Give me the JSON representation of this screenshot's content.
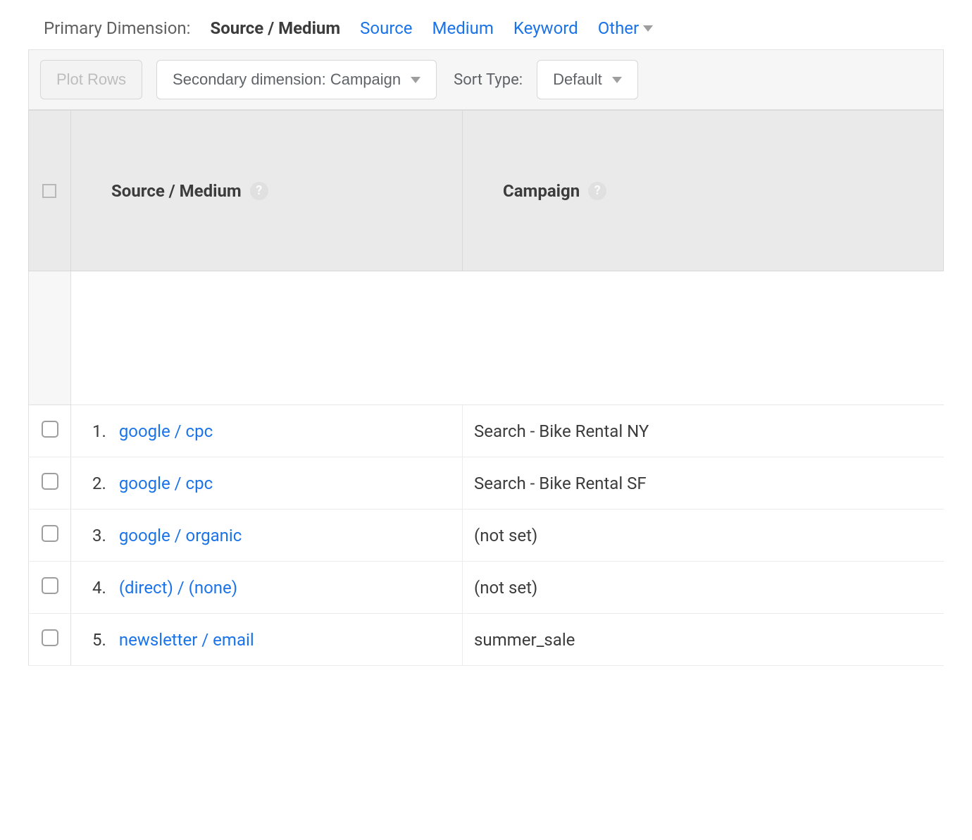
{
  "primary_dimension": {
    "label": "Primary Dimension:",
    "active": "Source / Medium",
    "links": [
      "Source",
      "Medium",
      "Keyword"
    ],
    "other": "Other"
  },
  "toolbar": {
    "plot_rows": "Plot Rows",
    "secondary_dimension": "Secondary dimension: Campaign",
    "sort_type_label": "Sort Type:",
    "sort_type_value": "Default"
  },
  "table": {
    "headers": {
      "source_medium": "Source / Medium",
      "campaign": "Campaign"
    },
    "rows": [
      {
        "n": "1.",
        "source": "google / cpc",
        "campaign": "Search - Bike Rental NY"
      },
      {
        "n": "2.",
        "source": "google / cpc",
        "campaign": "Search - Bike Rental SF"
      },
      {
        "n": "3.",
        "source": "google / organic",
        "campaign": "(not set)"
      },
      {
        "n": "4.",
        "source": "(direct) / (none)",
        "campaign": "(not set)"
      },
      {
        "n": "5.",
        "source": "newsletter / email",
        "campaign": "summer_sale"
      }
    ]
  }
}
